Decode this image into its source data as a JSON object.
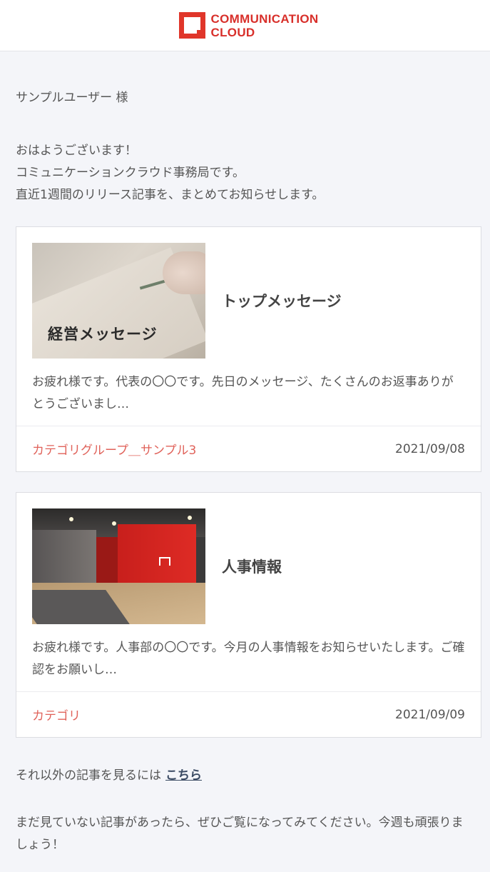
{
  "header": {
    "logo_line1": "COMMUNICATION",
    "logo_line2": "CLOUD",
    "accent": "#e0362a"
  },
  "greeting": {
    "name": "サンプルユーザー 様",
    "lines": [
      "おはようございます！",
      "コミュニケーションクラウド事務局です。",
      "直近1週間のリリース記事を、まとめてお知らせします。"
    ]
  },
  "articles": [
    {
      "thumbnail_label": "経営メッセージ",
      "title": "トップメッセージ",
      "excerpt": "お疲れ様です。代表の〇〇です。先日のメッセージ、たくさんのお返事ありがとうございまし…",
      "category": "カテゴリグループ＿サンプル3",
      "date": "2021/09/08"
    },
    {
      "title": "人事情報",
      "excerpt": "お疲れ様です。人事部の〇〇です。今月の人事情報をお知らせいたします。ご確認をお願いし…",
      "category": "カテゴリ",
      "date": "2021/09/09"
    }
  ],
  "footer": {
    "more_text": "それ以外の記事を見るには",
    "more_link": "こちら",
    "closing": "まだ見ていない記事があったら、ぜひご覧になってみてください。今週も頑張りましょう！"
  },
  "colors": {
    "background": "#f4f5f9",
    "category": "#e0625a",
    "link": "#3a4a63"
  }
}
